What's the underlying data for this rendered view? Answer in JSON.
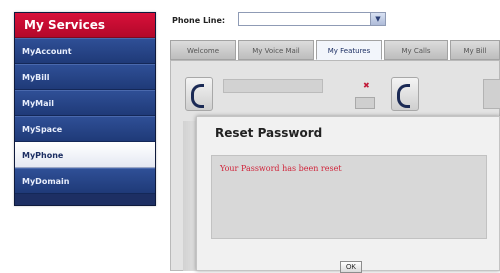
{
  "services": {
    "header": "My Services",
    "items": [
      {
        "label": "MyAccount"
      },
      {
        "label": "MyBill"
      },
      {
        "label": "MyMail"
      },
      {
        "label": "MySpace"
      },
      {
        "label": "MyPhone"
      },
      {
        "label": "MyDomain"
      }
    ],
    "active_index": 4
  },
  "phone_line": {
    "label": "Phone Line:",
    "value": ""
  },
  "tabs": [
    {
      "label": "Welcome"
    },
    {
      "label": "My Voice Mail"
    },
    {
      "label": "My Features"
    },
    {
      "label": "My Calls"
    },
    {
      "label": "My Bill"
    }
  ],
  "active_tab": 2,
  "dialog": {
    "title": "Reset Password",
    "message": "Your Password has been reset",
    "ok_label": "OK"
  },
  "colors": {
    "header_red": "#d8103a",
    "menu_blue": "#1d2f63",
    "message_red": "#d0243a"
  }
}
